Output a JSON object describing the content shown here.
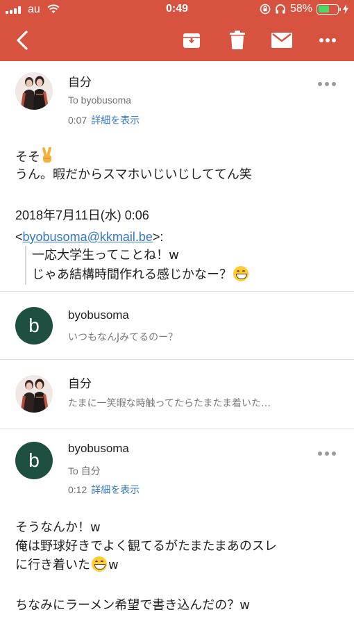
{
  "status_bar": {
    "carrier": "au",
    "time": "0:49",
    "battery": "58%",
    "battery_level": 0.58
  },
  "colors": {
    "header": "#d8533f",
    "link": "#3478c6",
    "avatar_b": "#1f4f41"
  },
  "toolbar": {
    "icons": [
      "back-icon",
      "archive-icon",
      "trash-icon",
      "mail-icon",
      "more-icon"
    ]
  },
  "messages": [
    {
      "sender": "自分",
      "to": "To byobusoma",
      "time": "0:07",
      "detail_link": "詳細を表示",
      "body_line1": "そそ",
      "body_line2": "うん。暇だからスマホいじいじしててん笑",
      "quote_date": "2018年7月11日(水) 0:06",
      "quote_open": "<",
      "quote_email": "byobusoma@kkmail.be",
      "quote_close": ">:",
      "quote_line1": "一応大学生ってことね！w",
      "quote_line2": "じゃあ結構時間作れる感じかなー？"
    },
    {
      "sender": "byobusoma",
      "avatar_letter": "b",
      "snippet": "いつもなんJみてるのー？"
    },
    {
      "sender": "自分",
      "snippet": "たまに一笑暇な時触ってたらたまたま着いた…"
    },
    {
      "sender": "byobusoma",
      "avatar_letter": "b",
      "to": "To 自分",
      "time": "0:12",
      "detail_link": "詳細を表示",
      "body_line1": "そうなんか！w",
      "body_line2": "俺は野球好きでよく観てるがたまたまあのスレ",
      "body_line3a": "に行き着いた",
      "body_line3b": "w",
      "body_line4": "ちなみにラーメン希望で書き込んだの？w"
    }
  ]
}
